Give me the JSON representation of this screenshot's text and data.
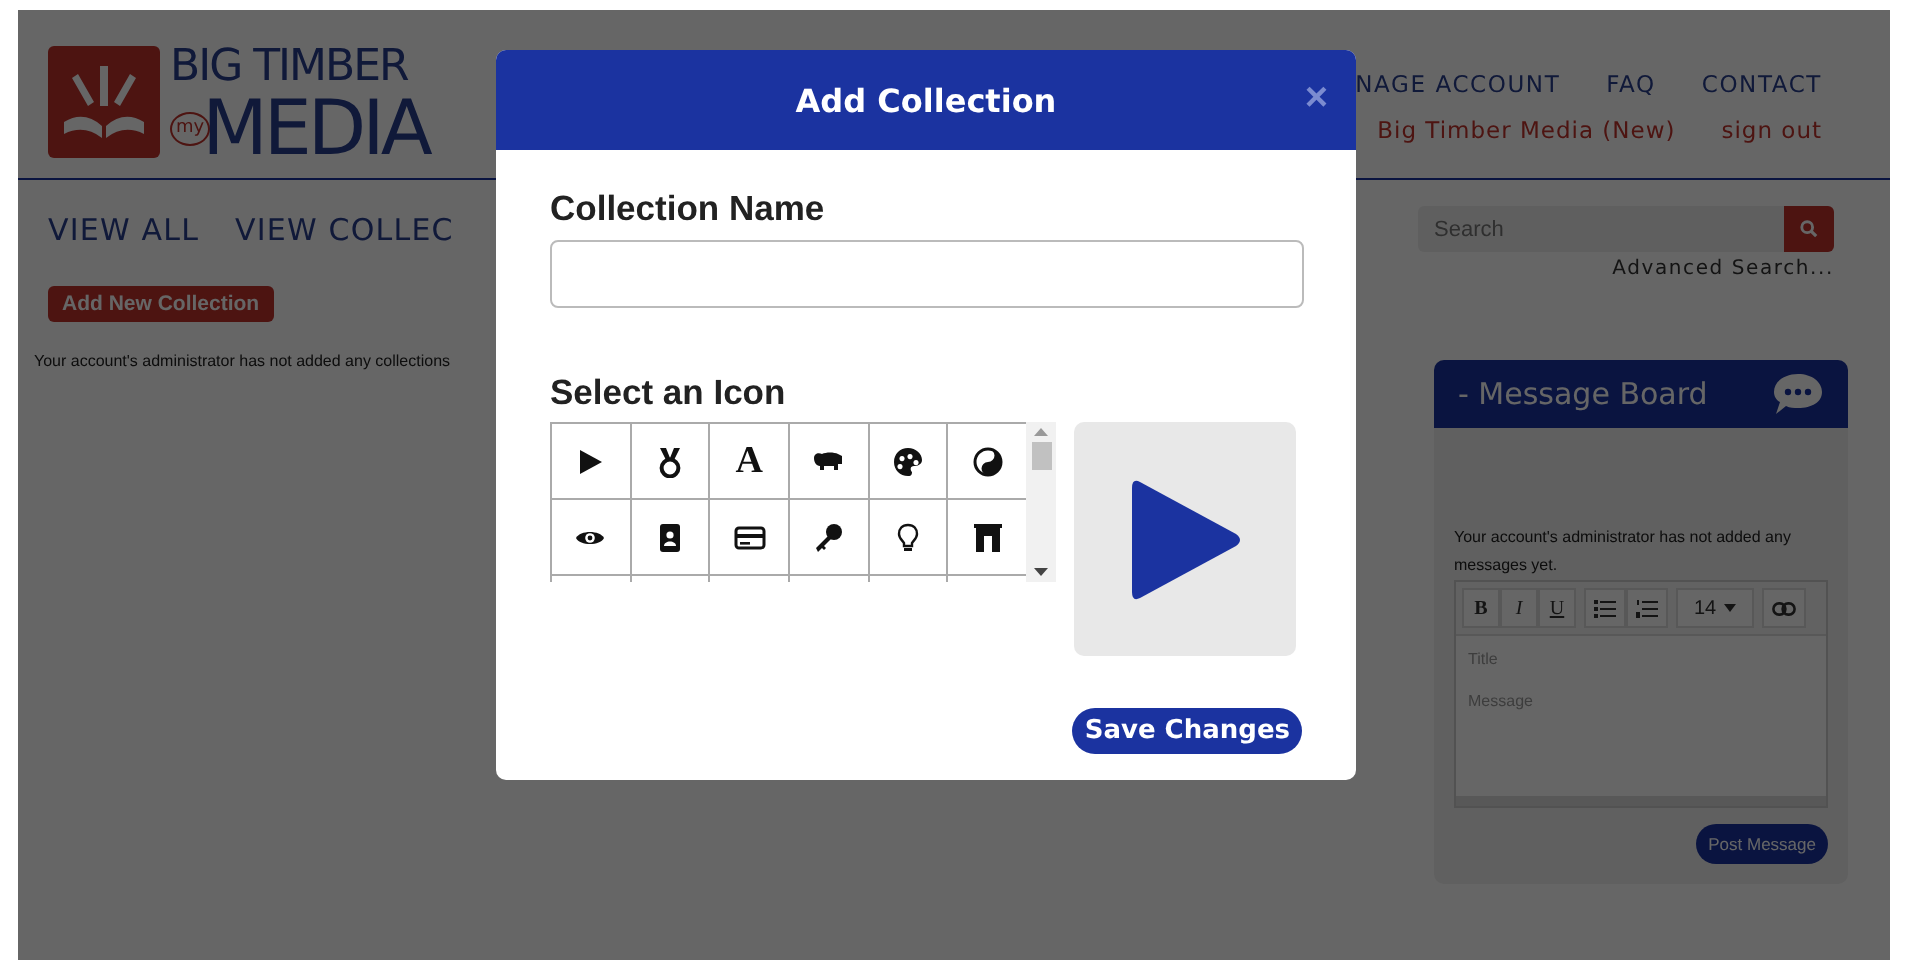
{
  "logo": {
    "top": "BIG TIMBER",
    "badge": "my",
    "bottom": "MEDIA"
  },
  "nav": {
    "links": [
      "NAGE ACCOUNT",
      "FAQ",
      "CONTACT"
    ],
    "account_links": [
      "Big Timber Media (New)",
      "sign out"
    ]
  },
  "view_tabs": [
    "VIEW ALL",
    "VIEW COLLEC"
  ],
  "add_button": "Add New Collection",
  "empty_message": "Your account's administrator has not added any collections",
  "search": {
    "placeholder": "Search",
    "advanced_link": "Advanced Search..."
  },
  "message_board": {
    "title": "- Message Board",
    "notice": "Your account's administrator has not added any messages yet.",
    "toolbar_groups": [
      [
        {
          "kind": "bold",
          "label": "B"
        },
        {
          "kind": "italic",
          "label": "I"
        },
        {
          "kind": "underline",
          "label": "U"
        }
      ],
      [
        {
          "kind": "bullets"
        },
        {
          "kind": "numbers"
        }
      ],
      [
        {
          "kind": "size",
          "label": "14"
        }
      ],
      [
        {
          "kind": "link"
        }
      ]
    ],
    "title_placeholder": "Title",
    "message_placeholder": "Message",
    "post_button": "Post Message"
  },
  "modal": {
    "title": "Add Collection",
    "close": "×",
    "name_label": "Collection Name",
    "icon_label": "Select an Icon",
    "icons": [
      {
        "kind": "play"
      },
      {
        "kind": "medal"
      },
      {
        "kind": "letter",
        "glyph": "A"
      },
      {
        "kind": "hippo"
      },
      {
        "kind": "palette"
      },
      {
        "kind": "yinyang"
      },
      {
        "kind": "eye"
      },
      {
        "kind": "badge"
      },
      {
        "kind": "card"
      },
      {
        "kind": "key"
      },
      {
        "kind": "bulb"
      },
      {
        "kind": "arch"
      }
    ],
    "preview": {
      "kind": "play"
    },
    "save_button": "Save Changes"
  }
}
